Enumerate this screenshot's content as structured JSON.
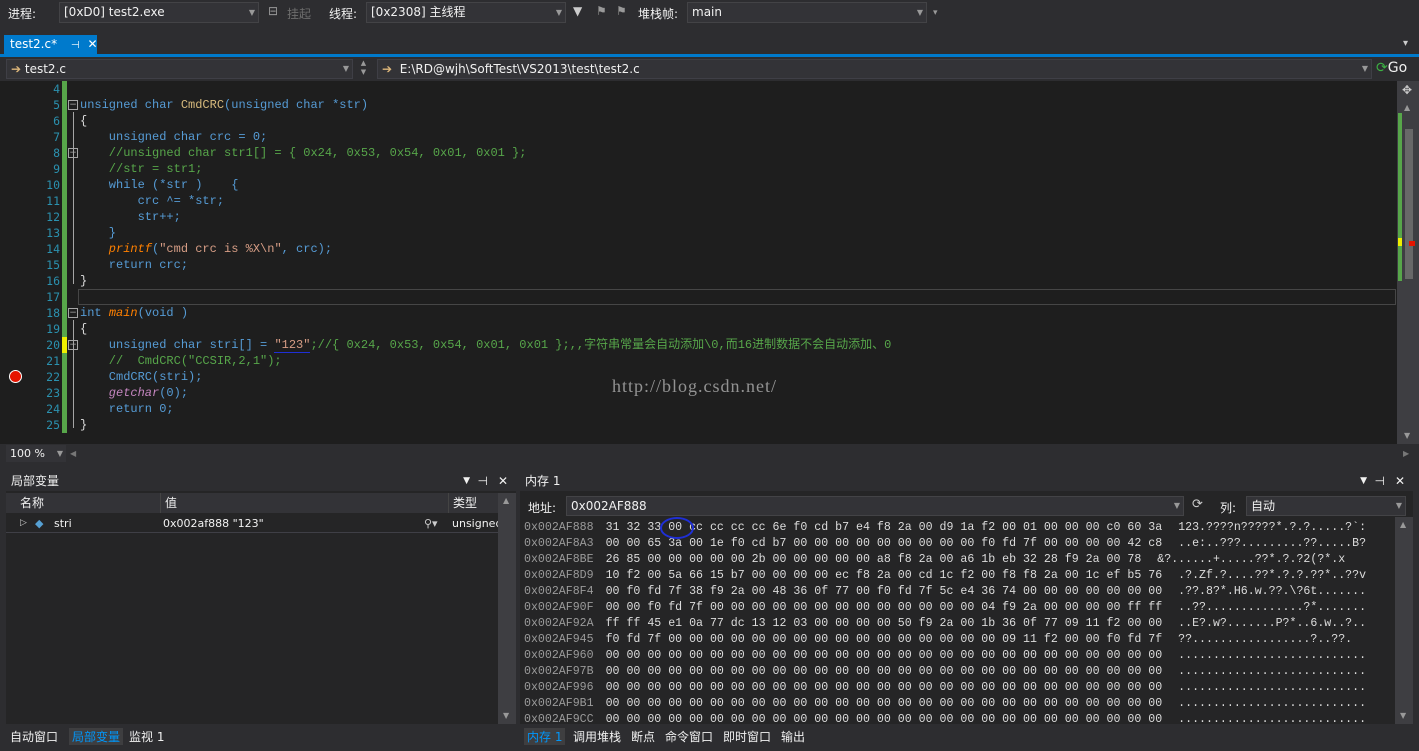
{
  "toolbar": {
    "process_label": "进程:",
    "process_value": "[0xD0] test2.exe",
    "suspend_label": "挂起",
    "thread_label": "线程:",
    "thread_value": "[0x2308] 主线程",
    "stackframe_label": "堆栈帧:",
    "stackframe_value": "main"
  },
  "tab": {
    "title": "test2.c*"
  },
  "nav": {
    "file": "test2.c",
    "path": "E:\\RD@wjh\\SoftTest\\VS2013\\test\\test2.c",
    "go_label": "Go"
  },
  "editor": {
    "line_numbers": [
      "4",
      "5",
      "6",
      "7",
      "8",
      "9",
      "10",
      "11",
      "12",
      "13",
      "14",
      "15",
      "16",
      "17",
      "18",
      "19",
      "20",
      "21",
      "22",
      "23",
      "24",
      "25"
    ],
    "watermark": "http://blog.csdn.net/"
  },
  "code": {
    "l5a": "unsigned char ",
    "l5b": "CmdCRC",
    "l5c": "(unsigned char *str)",
    "l6": "{",
    "l7a": "    unsigned char ",
    "l7b": "crc = 0;",
    "l8": "    //unsigned char str1[] = { 0x24, 0x53, 0x54, 0x01, 0x01 };",
    "l9": "    //str = str1;",
    "l10a": "    while ",
    "l10b": "(*str )    {",
    "l11": "        crc ^= *str;",
    "l12": "        str++;",
    "l13": "    }",
    "l14a": "    printf",
    "l14b": "(",
    "l14c": "\"cmd crc is %X\\n\"",
    "l14d": ", crc);",
    "l15a": "    return ",
    "l15b": "crc;",
    "l16": "}",
    "l18a": "int ",
    "l18b": "main",
    "l18c": "(void )",
    "l19": "{",
    "l20a": "    unsigned char ",
    "l20b": "stri[] = ",
    "l20c": "\"123\"",
    "l20d": ";//{ 0x24, 0x53, 0x54, 0x01, 0x01 };,,字符串常量会自动添加\\0,而16进制数据不会自动添加、0",
    "l21": "    //  CmdCRC(\"CCSIR,2,1\");",
    "l22": "    CmdCRC(stri);",
    "l23a": "    getchar",
    "l23b": "(0);",
    "l24a": "    return ",
    "l24b": "0;",
    "l25": "}"
  },
  "zoom": "100 %",
  "locals": {
    "title": "局部变量",
    "col_name": "名称",
    "col_value": "值",
    "col_type": "类型",
    "row_name": "stri",
    "row_value": "0x002af888 \"123\"",
    "row_type": "unsigned"
  },
  "memory": {
    "title": "内存 1",
    "address_label": "地址:",
    "address_value": "0x002AF888",
    "columns_label": "列:",
    "columns_value": "自动",
    "rows": [
      {
        "addr": "0x002AF888",
        "hex": "31 32 33 00 cc cc cc cc 6e f0 cd b7 e4 f8 2a 00 d9 1a f2 00 01 00 00 00 c0 60 3a",
        "ascii": "123.????n?????*.?.?.....?`:"
      },
      {
        "addr": "0x002AF8A3",
        "hex": "00 00 65 3a 00 1e f0 cd b7 00 00 00 00 00 00 00 00 00 f0 fd 7f 00 00 00 00 42 c8",
        "ascii": "..e:..???.........??.....B?"
      },
      {
        "addr": "0x002AF8BE",
        "hex": "26 85 00 00 00 00 00 2b 00 00 00 00 00 a8 f8 2a 00 a6 1b eb 32 28 f9 2a 00 78",
        "ascii": "&?......+.....??*.?.?2(?*.x"
      },
      {
        "addr": "0x002AF8D9",
        "hex": "10 f2 00 5a 66 15 b7 00 00 00 00 ec f8 2a 00 cd 1c f2 00 f8 f8 2a 00 1c ef b5 76",
        "ascii": ".?.Zf.?....??*.?.?.??*..??v"
      },
      {
        "addr": "0x002AF8F4",
        "hex": "00 f0 fd 7f 38 f9 2a 00 48 36 0f 77 00 f0 fd 7f 5c e4 36 74 00 00 00 00 00 00 00",
        "ascii": ".??.8?*.H6.w.??.\\?6t......."
      },
      {
        "addr": "0x002AF90F",
        "hex": "00 00 f0 fd 7f 00 00 00 00 00 00 00 00 00 00 00 00 00 04 f9 2a 00 00 00 00 ff ff",
        "ascii": "..??..............?*......."
      },
      {
        "addr": "0x002AF92A",
        "hex": "ff ff 45 e1 0a 77 dc 13 12 03 00 00 00 00 50 f9 2a 00 1b 36 0f 77 09 11 f2 00 00",
        "ascii": "..E?.w?.......P?*..6.w..?.."
      },
      {
        "addr": "0x002AF945",
        "hex": "f0 fd 7f 00 00 00 00 00 00 00 00 00 00 00 00 00 00 00 00 09 11 f2 00 00 f0 fd 7f",
        "ascii": "??.................?..??."
      },
      {
        "addr": "0x002AF960",
        "hex": "00 00 00 00 00 00 00 00 00 00 00 00 00 00 00 00 00 00 00 00 00 00 00 00 00 00 00",
        "ascii": "..........................."
      },
      {
        "addr": "0x002AF97B",
        "hex": "00 00 00 00 00 00 00 00 00 00 00 00 00 00 00 00 00 00 00 00 00 00 00 00 00 00 00",
        "ascii": "..........................."
      },
      {
        "addr": "0x002AF996",
        "hex": "00 00 00 00 00 00 00 00 00 00 00 00 00 00 00 00 00 00 00 00 00 00 00 00 00 00 00",
        "ascii": "..........................."
      },
      {
        "addr": "0x002AF9B1",
        "hex": "00 00 00 00 00 00 00 00 00 00 00 00 00 00 00 00 00 00 00 00 00 00 00 00 00 00 00",
        "ascii": "..........................."
      },
      {
        "addr": "0x002AF9CC",
        "hex": "00 00 00 00 00 00 00 00 00 00 00 00 00 00 00 00 00 00 00 00 00 00 00 00 00 00 00",
        "ascii": "..........................."
      }
    ]
  },
  "bottom_left_tabs": [
    "自动窗口",
    "局部变量",
    "监视 1"
  ],
  "bottom_right_tabs": [
    "内存 1",
    "调用堆栈",
    "断点",
    "命令窗口",
    "即时窗口",
    "输出"
  ]
}
